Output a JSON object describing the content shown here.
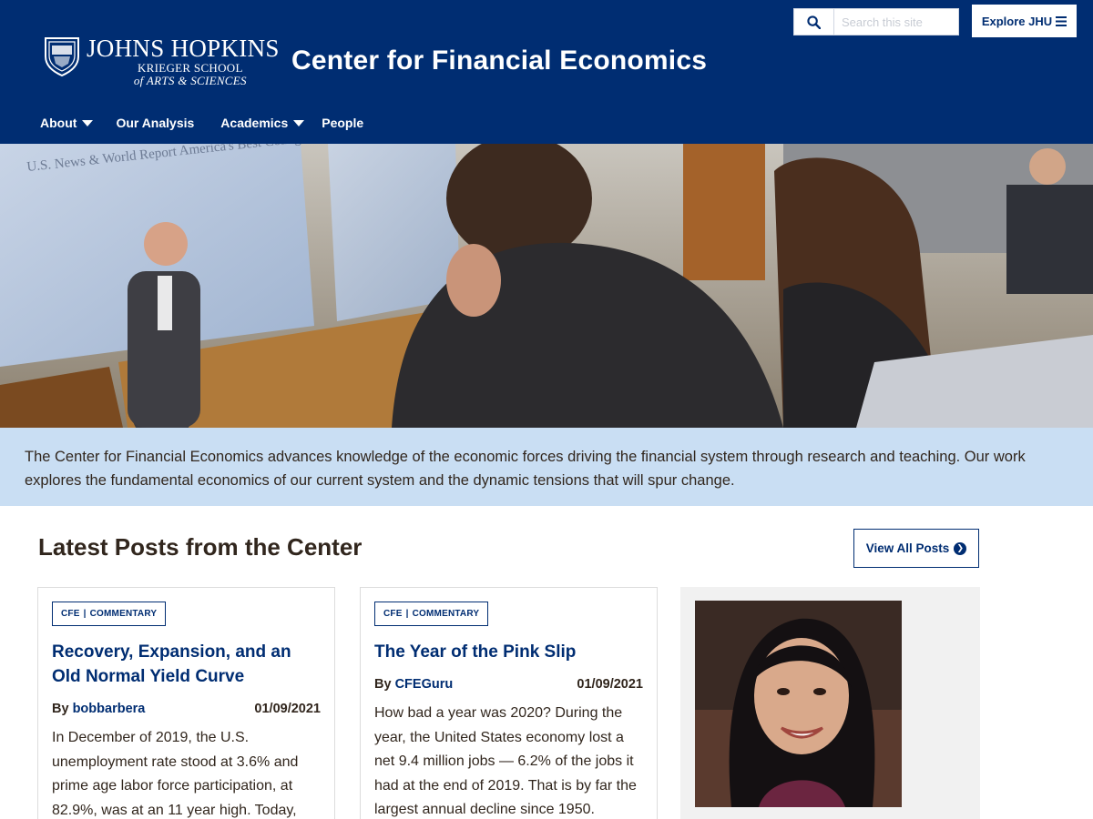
{
  "header": {
    "logo": {
      "university": "JOHNS HOPKINS",
      "school_line1": "KRIEGER SCHOOL",
      "school_line2": "of ARTS & SCIENCES"
    },
    "site_title": "Center for Financial Economics",
    "search": {
      "placeholder": "Search this site",
      "icon": "search-icon"
    },
    "explore_label": "Explore JHU",
    "nav": [
      {
        "label": "About",
        "has_dropdown": true
      },
      {
        "label": "Our Analysis",
        "has_dropdown": false
      },
      {
        "label": "Academics",
        "has_dropdown": true
      },
      {
        "label": "People",
        "has_dropdown": false
      }
    ]
  },
  "hero": {
    "screen_text": "U.S. News & World Report America's Best Colleges"
  },
  "intro": {
    "text": "The Center for Financial Economics advances knowledge of the economic forces driving the financial system through research and teaching. Our work explores the fundamental economics of our current system and the dynamic tensions that will spur change."
  },
  "posts": {
    "heading": "Latest Posts from the Center",
    "view_all_label": "View All Posts",
    "items": [
      {
        "tag_primary": "CFE",
        "tag_secondary": "COMMENTARY",
        "title": "Recovery, Expansion, and an Old Normal Yield Curve",
        "by_label": "By",
        "author": "bobbarbera",
        "date": "01/09/2021",
        "excerpt": "In December of 2019, the U.S. unemployment rate stood at 3.6% and prime age labor force participation, at 82.9%, was at an 11 year high. Today,"
      },
      {
        "tag_primary": "CFE",
        "tag_secondary": "COMMENTARY",
        "title": "The Year of the Pink Slip",
        "by_label": "By",
        "author": "CFEGuru",
        "date": "01/09/2021",
        "excerpt": "How bad a year was 2020? During the year, the United States economy lost a net 9.4 million jobs — 6.2% of the jobs it had at the end of 2019. That is by far the largest annual decline since 1950."
      }
    ]
  },
  "colors": {
    "brand_blue": "#002d72",
    "intro_bg": "#c9def3",
    "text": "#31261d"
  }
}
